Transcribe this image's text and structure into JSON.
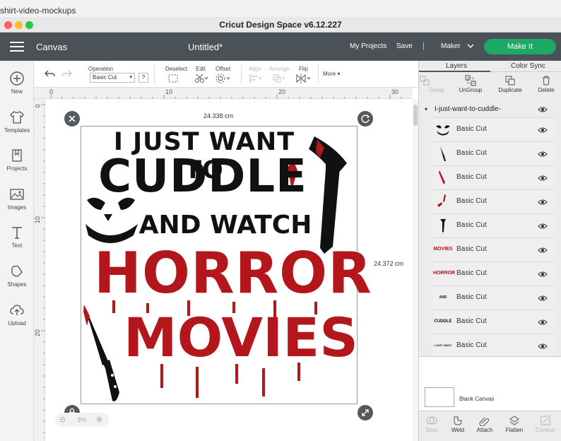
{
  "os": {
    "folder": "shirt-video-mockups"
  },
  "window": {
    "title": "Cricut Design Space  v6.12.227"
  },
  "header": {
    "canvas_label": "Canvas",
    "project_title": "Untitled*",
    "my_projects": "My Projects",
    "save": "Save",
    "divider": "|",
    "machine": "Maker",
    "make_it": "Make It"
  },
  "sidebar": {
    "items": [
      {
        "label": "New",
        "icon": "plus-circle-icon"
      },
      {
        "label": "Templates",
        "icon": "tshirt-icon"
      },
      {
        "label": "Projects",
        "icon": "projects-icon"
      },
      {
        "label": "Images",
        "icon": "image-icon"
      },
      {
        "label": "Text",
        "icon": "text-t-icon"
      },
      {
        "label": "Shapes",
        "icon": "shapes-icon"
      },
      {
        "label": "Upload",
        "icon": "upload-cloud-icon"
      }
    ]
  },
  "toolbar": {
    "operation_label": "Operation",
    "operation_value": "Basic Cut",
    "help": "?",
    "deselect": "Deselect",
    "edit": "Edit",
    "offset": "Offset",
    "align": "Align",
    "arrange": "Arrange",
    "flip": "Flip",
    "more": "More"
  },
  "rulers": {
    "top": [
      "0",
      "10",
      "20",
      "30"
    ],
    "left": [
      "0",
      "10",
      "20"
    ]
  },
  "canvas": {
    "width_label": "24.338 cm",
    "height_label": "24.372 cm",
    "zoom": "3%"
  },
  "design": {
    "line1": "I JUST WANT TO",
    "line2": "CUDDLE",
    "line3": "AND WATCH",
    "line4": "HORROR",
    "line5": "MOVIES",
    "black": "#111111",
    "red": "#b3161b"
  },
  "panel": {
    "tab_layers": "Layers",
    "tab_color_sync": "Color Sync",
    "actions": [
      {
        "label": "Group",
        "icon": "group-icon",
        "enabled": false
      },
      {
        "label": "UnGroup",
        "icon": "ungroup-icon",
        "enabled": true
      },
      {
        "label": "Duplicate",
        "icon": "duplicate-icon",
        "enabled": true
      },
      {
        "label": "Delete",
        "icon": "trash-icon",
        "enabled": true
      }
    ],
    "group_name": "I-just-want-to-cuddle-",
    "layers": [
      {
        "name": "Basic Cut",
        "thumb": "face"
      },
      {
        "name": "Basic Cut",
        "thumb": "knife"
      },
      {
        "name": "Basic Cut",
        "thumb": "blood"
      },
      {
        "name": "Basic Cut",
        "thumb": "drops"
      },
      {
        "name": "Basic Cut",
        "thumb": "axe"
      },
      {
        "name": "Basic Cut",
        "thumb": "MOVIES"
      },
      {
        "name": "Basic Cut",
        "thumb": "HORROR"
      },
      {
        "name": "Basic Cut",
        "thumb": "AND WATCH"
      },
      {
        "name": "Basic Cut",
        "thumb": "CUDDLE"
      },
      {
        "name": "Basic Cut",
        "thumb": "I JUST WANT TO"
      }
    ],
    "blank_canvas": "Blank Canvas",
    "bottom_actions": [
      {
        "label": "Slice",
        "icon": "slice-icon",
        "enabled": false
      },
      {
        "label": "Weld",
        "icon": "weld-icon",
        "enabled": true
      },
      {
        "label": "Attach",
        "icon": "attach-icon",
        "enabled": true
      },
      {
        "label": "Flatten",
        "icon": "flatten-icon",
        "enabled": true
      },
      {
        "label": "Contour",
        "icon": "contour-icon",
        "enabled": false
      }
    ]
  }
}
